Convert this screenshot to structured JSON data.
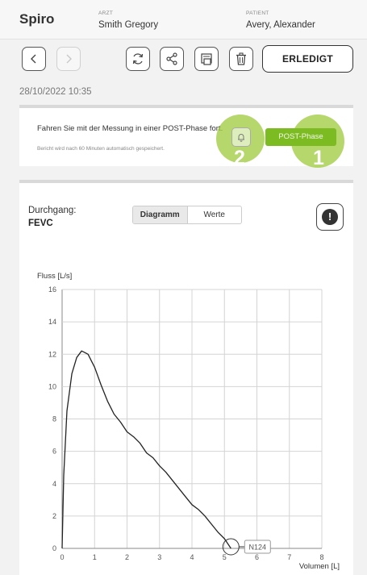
{
  "header": {
    "app_title": "Spiro",
    "doctor_label": "ARZT",
    "doctor_name": "Smith Gregory",
    "patient_label": "PATIENT",
    "patient_name": "Avery, Alexander"
  },
  "toolbar": {
    "done_label": "ERLEDIGT",
    "icons": [
      "chevron-left-icon",
      "chevron-right-icon",
      "refresh-icon",
      "share-icon",
      "print-icon",
      "trash-icon"
    ]
  },
  "session": {
    "datetime": "28/10/2022 10:35"
  },
  "post_phase_card": {
    "message": "Fahren Sie mit der Messung in einer POST-Phase fort.",
    "note": "Bericht wird nach 60 Minuten automatisch gespeichert.",
    "button_label": "POST-Phase",
    "badge_bell": "2",
    "badge_post": "1",
    "accent_color": "#7dbb22"
  },
  "trial": {
    "label": "Durchgang:",
    "value": "FEVC",
    "tabs": [
      {
        "label": "Diagramm",
        "active": true
      },
      {
        "label": "Werte",
        "active": false
      }
    ],
    "warning_icon": "!"
  },
  "chart_data": {
    "type": "line",
    "ylabel": "Fluss [L/s]",
    "xlabel": "Volumen [L]",
    "xlim": [
      0,
      8
    ],
    "ylim": [
      0,
      16
    ],
    "xticks": [
      0,
      1,
      2,
      3,
      4,
      5,
      6,
      7,
      8
    ],
    "yticks": [
      0,
      2,
      4,
      6,
      8,
      10,
      12,
      14,
      16
    ],
    "grid": true,
    "series": [
      {
        "x": [
          0,
          0.05,
          0.15,
          0.3,
          0.45,
          0.6,
          0.7,
          0.8,
          0.9,
          1.0,
          1.2,
          1.4,
          1.6,
          1.8,
          2.0,
          2.2,
          2.4,
          2.6,
          2.8,
          3.0,
          3.2,
          3.4,
          3.6,
          3.8,
          4.0,
          4.2,
          4.4,
          4.6,
          4.8,
          5.0,
          5.1,
          5.2
        ],
        "y": [
          0,
          4.5,
          8.5,
          10.8,
          11.8,
          12.2,
          12.1,
          12.0,
          11.6,
          11.2,
          10.1,
          9.1,
          8.3,
          7.8,
          7.2,
          6.9,
          6.5,
          5.9,
          5.6,
          5.1,
          4.7,
          4.2,
          3.7,
          3.2,
          2.7,
          2.4,
          2.0,
          1.5,
          1.0,
          0.6,
          0.3,
          0.0
        ]
      }
    ],
    "marker": {
      "x": 5.2,
      "y": 0,
      "label": "N124"
    }
  }
}
